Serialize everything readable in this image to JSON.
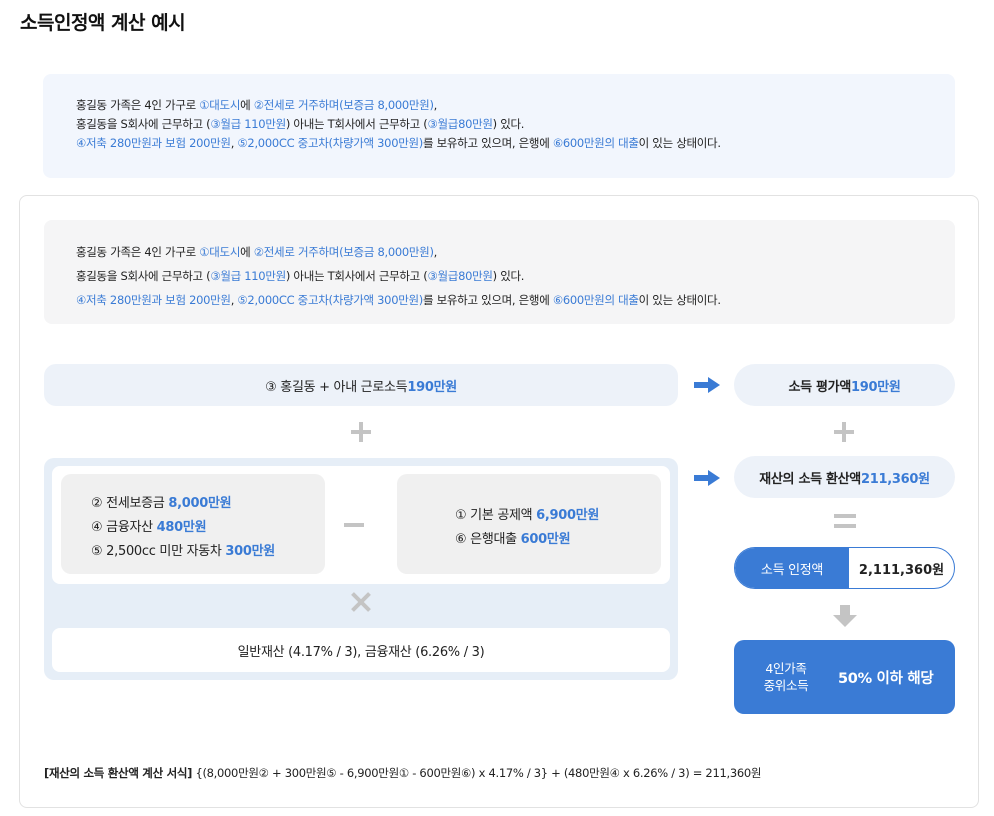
{
  "title": "소득인정액 계산 예시",
  "scenario": {
    "l1_a": "홍길동 가족은 4인 가구로 ",
    "l1_b": "①대도시",
    "l1_c": "에 ",
    "l1_d": "②전세로 거주하며(보증금 8,000만원)",
    "l1_e": ",",
    "l2_a": "홍길동을 S회사에 근무하고 (",
    "l2_b": "③월급 110만원",
    "l2_c": ") 아내는 T회사에서 근무하고 (",
    "l2_d": "③월급80만원",
    "l2_e": ") 있다.",
    "l3_a": "④저축 280만원과 보험 200만원",
    "l3_b": ", ",
    "l3_c": "⑤2,000CC 중고차(차량가액 300만원)",
    "l3_d": "를 보유하고 있으며, 은행에 ",
    "l3_e": "⑥600만원의 대출",
    "l3_f": "이 있는 상태이다."
  },
  "income": {
    "label": "③ 홍길동 + 아내 근로소득 ",
    "value": "190만원"
  },
  "income_eval": {
    "label": "소득 평가액 ",
    "value": "190만원"
  },
  "asset_eval": {
    "label": "재산의 소득 환산액 ",
    "value": "211,360원"
  },
  "assets_add": [
    {
      "label": "② 전세보증금 ",
      "value": "8,000만원"
    },
    {
      "label": "④ 금융자산 ",
      "value": "480만원"
    },
    {
      "label": "⑤ 2,500cc 미만 자동차 ",
      "value": "300만원"
    }
  ],
  "assets_sub": [
    {
      "label": "① 기본 공제액 ",
      "value": "6,900만원"
    },
    {
      "label": "⑥ 은행대출 ",
      "value": "600만원"
    }
  ],
  "rates": "일반재산 (4.17% / 3), 금융재산 (6.26% / 3)",
  "recognized": {
    "label": "소득 인정액",
    "value": "2,111,360원"
  },
  "median": {
    "label_1": "4인가족",
    "label_2": "중위소득",
    "result": "50% 이하 해당"
  },
  "formula": {
    "label": "[재산의 소득 환산액 계산 서식]",
    "expr": " {(8,000만원② + 300만원⑤ - 6,900만원① - 600만원⑥) x 4.17% / 3} + (480만원④ x 6.26% / 3) = 211,360원"
  },
  "colors": {
    "accent": "#3a7bd5",
    "panel": "#e6eef7",
    "operator": "#c4c4c4"
  }
}
